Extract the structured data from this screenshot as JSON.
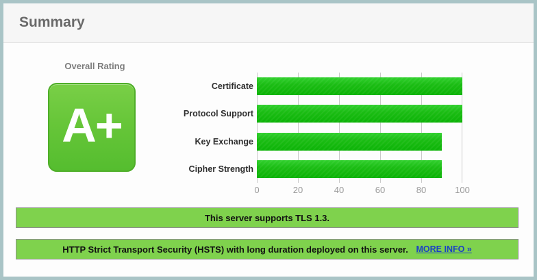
{
  "panel": {
    "title": "Summary"
  },
  "rating": {
    "label": "Overall Rating",
    "grade": "A+"
  },
  "chart_data": {
    "type": "bar",
    "orientation": "horizontal",
    "categories": [
      "Certificate",
      "Protocol Support",
      "Key Exchange",
      "Cipher Strength"
    ],
    "values": [
      100,
      100,
      90,
      90
    ],
    "xlim": [
      0,
      100
    ],
    "x_ticks": [
      0,
      20,
      40,
      60,
      80,
      100
    ],
    "grid": true,
    "legend": false,
    "title": "",
    "xlabel": "",
    "ylabel": "",
    "bar_color": "#1bbd14"
  },
  "banners": {
    "tls": {
      "text": "This server supports TLS 1.3."
    },
    "hsts": {
      "text": "HTTP Strict Transport Security (HSTS) with long duration deployed on this server. ",
      "link_label": "MORE INFO »"
    }
  },
  "colors": {
    "panel_border": "#a9c4c6",
    "header_bg": "#f6f6f6",
    "badge_green": "#67c639",
    "badge_border": "#4fae29",
    "bar_green": "#1bbd14",
    "banner_green": "#7fd24d",
    "banner_border": "#8e8e8e",
    "link_blue": "#1b41c4"
  }
}
